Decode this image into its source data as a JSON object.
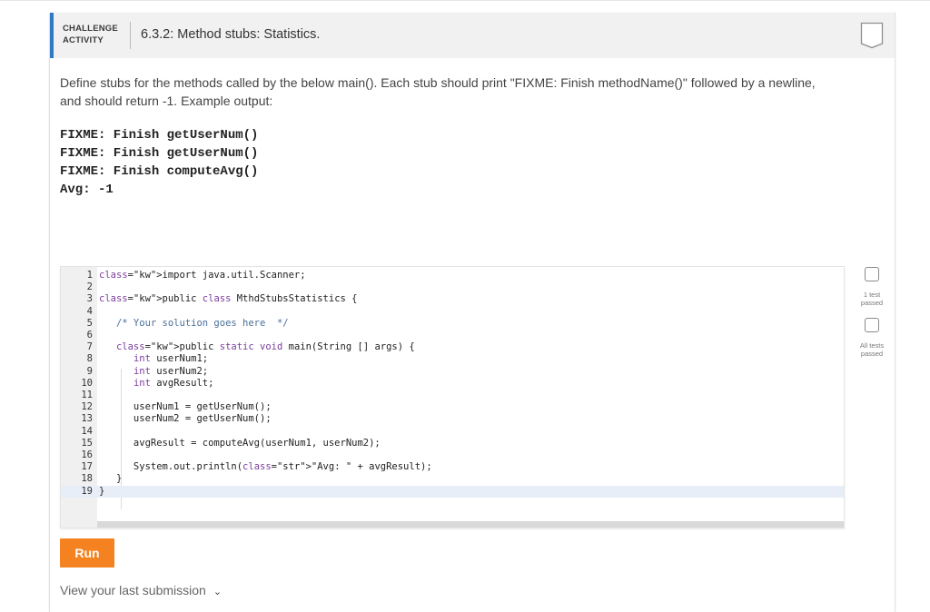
{
  "activity": {
    "label_line1": "CHALLENGE",
    "label_line2": "ACTIVITY",
    "title": "6.3.2: Method stubs: Statistics."
  },
  "description": "Define stubs for the methods called by the below main(). Each stub should print \"FIXME: Finish methodName()\" followed by a newline, and should return -1. Example output:",
  "example_output": [
    "FIXME: Finish getUserNum()",
    "FIXME: Finish getUserNum()",
    "FIXME: Finish computeAvg()",
    "Avg: -1"
  ],
  "code_lines": [
    {
      "n": "1",
      "text": "import java.util.Scanner;"
    },
    {
      "n": "2",
      "text": ""
    },
    {
      "n": "3",
      "text": "public class MthdStubsStatistics {"
    },
    {
      "n": "4",
      "text": ""
    },
    {
      "n": "5",
      "text": "   /* Your solution goes here  */"
    },
    {
      "n": "6",
      "text": ""
    },
    {
      "n": "7",
      "text": "   public static void main(String [] args) {"
    },
    {
      "n": "8",
      "text": "      int userNum1;"
    },
    {
      "n": "9",
      "text": "      int userNum2;"
    },
    {
      "n": "10",
      "text": "      int avgResult;"
    },
    {
      "n": "11",
      "text": ""
    },
    {
      "n": "12",
      "text": "      userNum1 = getUserNum();"
    },
    {
      "n": "13",
      "text": "      userNum2 = getUserNum();"
    },
    {
      "n": "14",
      "text": ""
    },
    {
      "n": "15",
      "text": "      avgResult = computeAvg(userNum1, userNum2);"
    },
    {
      "n": "16",
      "text": ""
    },
    {
      "n": "17",
      "text": "      System.out.println(\"Avg: \" + avgResult);"
    },
    {
      "n": "18",
      "text": "   }"
    },
    {
      "n": "19",
      "text": "}"
    }
  ],
  "tests": {
    "first_label": "1 test passed",
    "second_label": "All tests passed"
  },
  "run_label": "Run",
  "last_submission_label": "View your last submission",
  "colors": {
    "accent_blue": "#3079c4",
    "run_orange": "#f58220"
  }
}
